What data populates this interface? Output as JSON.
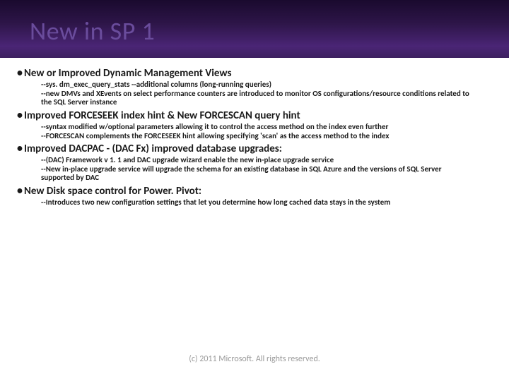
{
  "title": "New in SP 1",
  "sections": [
    {
      "heading": "New or Improved Dynamic Management Views",
      "items": [
        "--sys. dm_exec_query_stats --additional columns (long-running queries)",
        "--new DMVs and XEvents on select performance counters are introduced to monitor OS configurations/resource conditions related to the SQL Server instance"
      ]
    },
    {
      "heading": "Improved FORCESEEK index hint & New FORCESCAN query hint",
      "items": [
        "--syntax  modified w/optional parameters allowing it to control the access method on the index even further",
        "--FORCESCAN complements the FORCESEEK hint allowing specifying 'scan' as the access method to the index"
      ]
    },
    {
      "heading": "Improved DACPAC - (DAC Fx) improved database upgrades:",
      "items": [
        "--(DAC) Framework v 1. 1 and DAC upgrade wizard enable the new in-place upgrade service",
        "--New in-place upgrade service will upgrade the schema for an existing database in SQL Azure and the versions of SQL Server supported by DAC"
      ]
    },
    {
      "heading": "New Disk space control for Power. Pivot:",
      "items": [
        "--Introduces two new configuration settings that let you determine how long cached data stays in the system"
      ]
    }
  ],
  "footer": "(c) 2011 Microsoft. All rights reserved."
}
